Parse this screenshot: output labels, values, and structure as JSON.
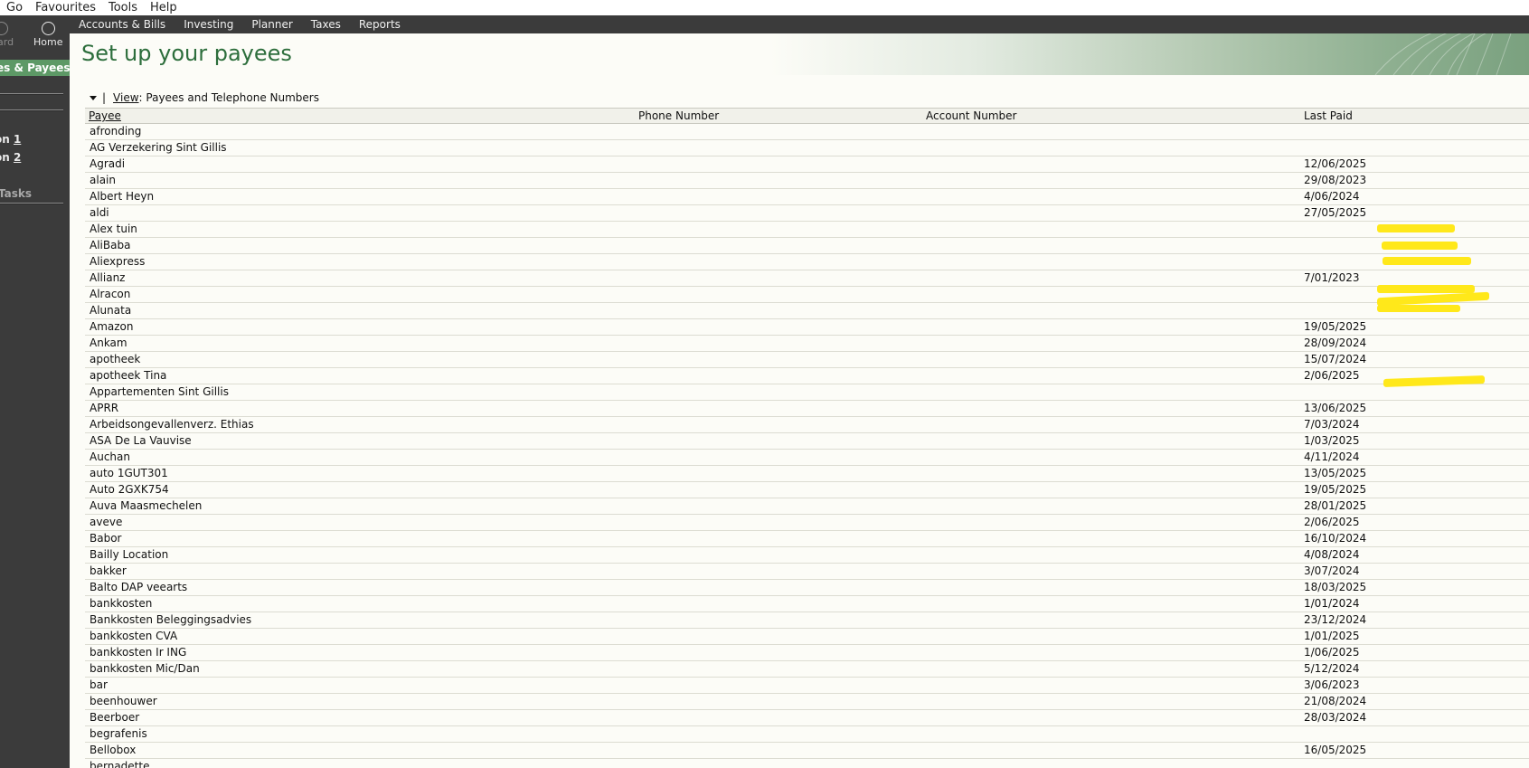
{
  "menu": [
    "Go",
    "Favourites",
    "Tools",
    "Help"
  ],
  "leftpane": {
    "forward_label": "ward",
    "home_label": "Home",
    "section_title": "es & Payees",
    "option1_prefix": "on ",
    "option1_num": "1",
    "option2_prefix": "on ",
    "option2_num": "2",
    "tasks_label": "Tasks"
  },
  "nav_tabs": [
    "Accounts & Bills",
    "Investing",
    "Planner",
    "Taxes",
    "Reports"
  ],
  "page": {
    "title": "Set up your payees",
    "view_prefix": "View",
    "view_value": ": Payees and Telephone Numbers"
  },
  "columns": {
    "payee": "Payee",
    "phone": "Phone Number",
    "account": "Account Number",
    "last_paid": "Last Paid"
  },
  "rows": [
    {
      "payee": "afronding",
      "last_paid": ""
    },
    {
      "payee": "AG Verzekering Sint Gillis",
      "last_paid": ""
    },
    {
      "payee": "Agradi",
      "last_paid": "12/06/2025"
    },
    {
      "payee": "alain",
      "last_paid": "29/08/2023"
    },
    {
      "payee": "Albert Heyn",
      "last_paid": "4/06/2024"
    },
    {
      "payee": "aldi",
      "last_paid": "27/05/2025"
    },
    {
      "payee": "Alex tuin",
      "last_paid": ""
    },
    {
      "payee": "AliBaba",
      "last_paid": ""
    },
    {
      "payee": "Aliexpress",
      "last_paid": ""
    },
    {
      "payee": "Allianz",
      "last_paid": "7/01/2023"
    },
    {
      "payee": "Alracon",
      "last_paid": ""
    },
    {
      "payee": "Alunata",
      "last_paid": ""
    },
    {
      "payee": "Amazon",
      "last_paid": "19/05/2025"
    },
    {
      "payee": "Ankam",
      "last_paid": "28/09/2024"
    },
    {
      "payee": "apotheek",
      "last_paid": "15/07/2024"
    },
    {
      "payee": "apotheek Tina",
      "last_paid": "2/06/2025"
    },
    {
      "payee": "Appartementen Sint Gillis",
      "last_paid": ""
    },
    {
      "payee": "APRR",
      "last_paid": "13/06/2025"
    },
    {
      "payee": "Arbeidsongevallenverz. Ethias",
      "last_paid": "7/03/2024"
    },
    {
      "payee": "ASA De La Vauvise",
      "last_paid": "1/03/2025"
    },
    {
      "payee": "Auchan",
      "last_paid": "4/11/2024"
    },
    {
      "payee": "auto 1GUT301",
      "last_paid": "13/05/2025"
    },
    {
      "payee": "Auto 2GXK754",
      "last_paid": "19/05/2025"
    },
    {
      "payee": "Auva Maasmechelen",
      "last_paid": "28/01/2025"
    },
    {
      "payee": "aveve",
      "last_paid": "2/06/2025"
    },
    {
      "payee": "Babor",
      "last_paid": "16/10/2024"
    },
    {
      "payee": "Bailly Location",
      "last_paid": "4/08/2024"
    },
    {
      "payee": "bakker",
      "last_paid": "3/07/2024"
    },
    {
      "payee": "Balto DAP veearts",
      "last_paid": "18/03/2025"
    },
    {
      "payee": "bankkosten",
      "last_paid": "1/01/2024"
    },
    {
      "payee": "Bankkosten Beleggingsadvies",
      "last_paid": "23/12/2024"
    },
    {
      "payee": "bankkosten CVA",
      "last_paid": "1/01/2025"
    },
    {
      "payee": "bankkosten Ir ING",
      "last_paid": "1/06/2025"
    },
    {
      "payee": "bankkosten Mic/Dan",
      "last_paid": "5/12/2024"
    },
    {
      "payee": "bar",
      "last_paid": "3/06/2023"
    },
    {
      "payee": "beenhouwer",
      "last_paid": "21/08/2024"
    },
    {
      "payee": "Beerboer",
      "last_paid": "28/03/2024"
    },
    {
      "payee": "begrafenis",
      "last_paid": ""
    },
    {
      "payee": "Bellobox",
      "last_paid": "16/05/2025"
    },
    {
      "payee": "bernadette",
      "last_paid": ""
    }
  ],
  "colors": {
    "accent_green": "#2d6e3c",
    "section_green": "#5d9966",
    "frame": "#3b3b3b",
    "highlight": "#ffe81a"
  }
}
